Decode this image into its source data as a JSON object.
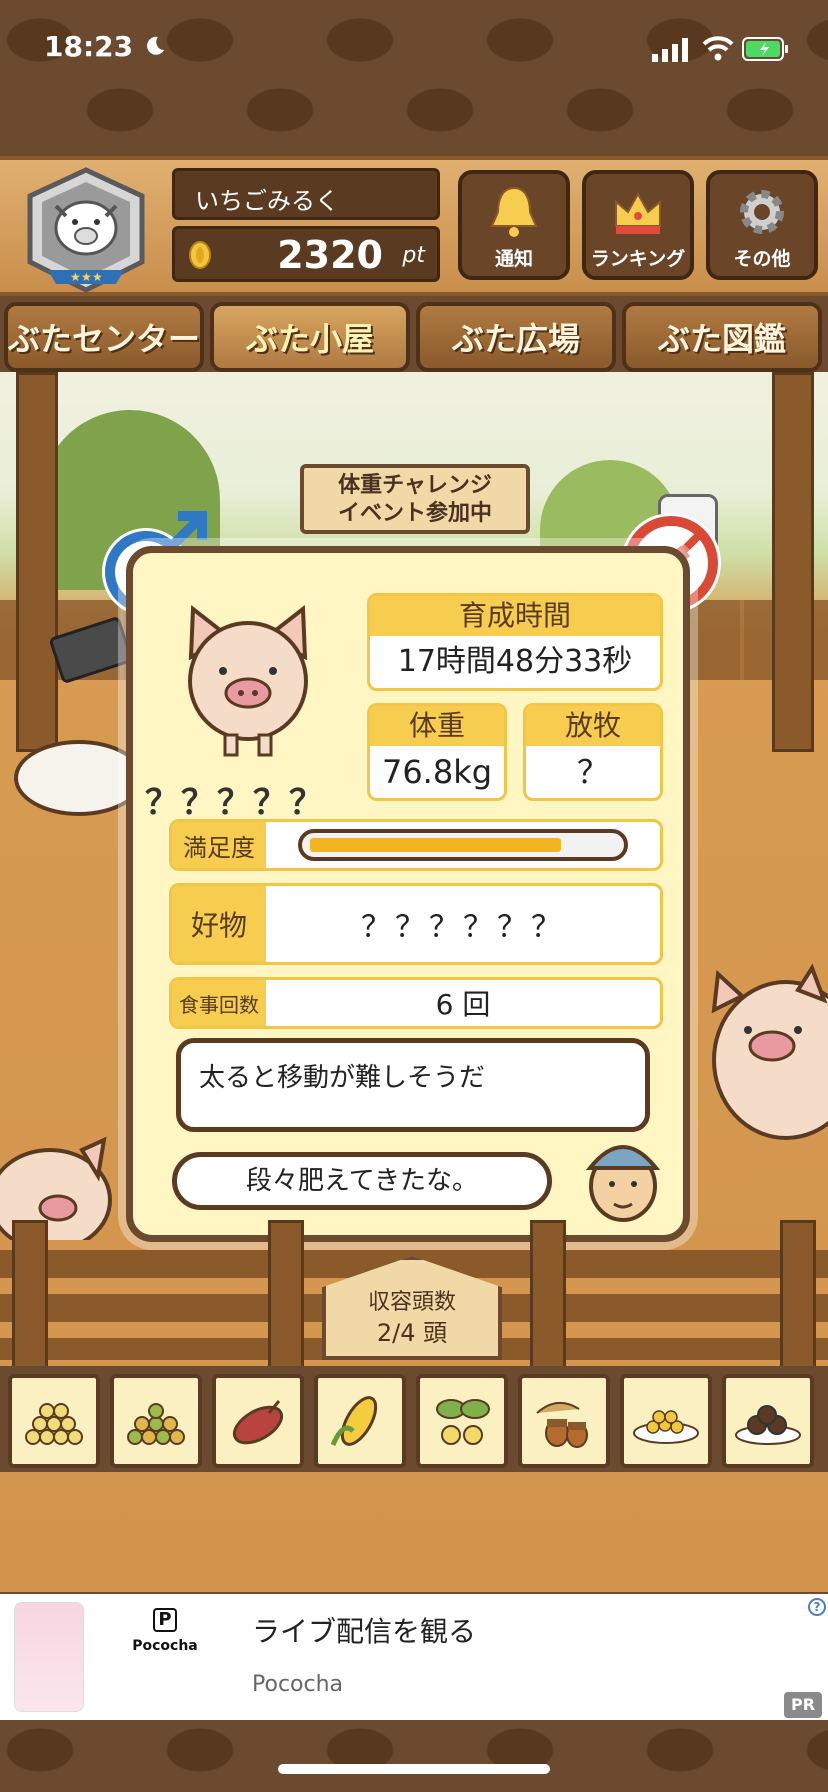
{
  "status_bar": {
    "time": "18:23"
  },
  "header": {
    "player_name": "いちごみるく",
    "points": "2320",
    "points_unit": "pt",
    "buttons": [
      {
        "label": "通知",
        "icon": "bell-icon"
      },
      {
        "label": "ランキング",
        "icon": "crown-icon"
      },
      {
        "label": "その他",
        "icon": "gear-icon"
      }
    ]
  },
  "nav_tabs": [
    {
      "label": "ぶたセンター",
      "active": false
    },
    {
      "label": "ぶた小屋",
      "active": true
    },
    {
      "label": "ぶた広場",
      "active": false
    },
    {
      "label": "ぶた図鑑",
      "active": false
    }
  ],
  "scene": {
    "event_sign": [
      "体重チャレンジ",
      "イベント参加中"
    ],
    "gender_label": "オス"
  },
  "pig_card": {
    "name": "？？？？？",
    "raise_time_label": "育成時間",
    "raise_time_value": "17時間48分33秒",
    "weight_label": "体重",
    "weight_value": "76.8kg",
    "grazing_label": "放牧",
    "grazing_value": "？",
    "satisfaction_label": "満足度",
    "satisfaction_level": 0.82,
    "favorite_label": "好物",
    "favorite_value": "？？？？？？",
    "meals_label": "食事回数",
    "meals_value": "6 回",
    "speech_text": "太ると移動が難しそうだ",
    "farmer_text": "段々肥えてきたな。"
  },
  "capacity": {
    "label": "収容頭数",
    "value": "2/4 頭"
  },
  "food_items": [
    "soybean-icon",
    "mixed-beans-icon",
    "sweet-potato-icon",
    "corn-icon",
    "ginkgo-icon",
    "acorn-icon",
    "grain-bowl-icon",
    "chestnut-plate-icon"
  ],
  "ad": {
    "title": "ライブ配信を観る",
    "advertiser": "Pococha",
    "brand_mark": "P",
    "brand_name": "Pococha",
    "pr_label": "PR"
  },
  "colors": {
    "accent_yellow": "#f6cd4e",
    "wood_dark": "#6b4a2f",
    "card_bg": "#fff6c4"
  }
}
